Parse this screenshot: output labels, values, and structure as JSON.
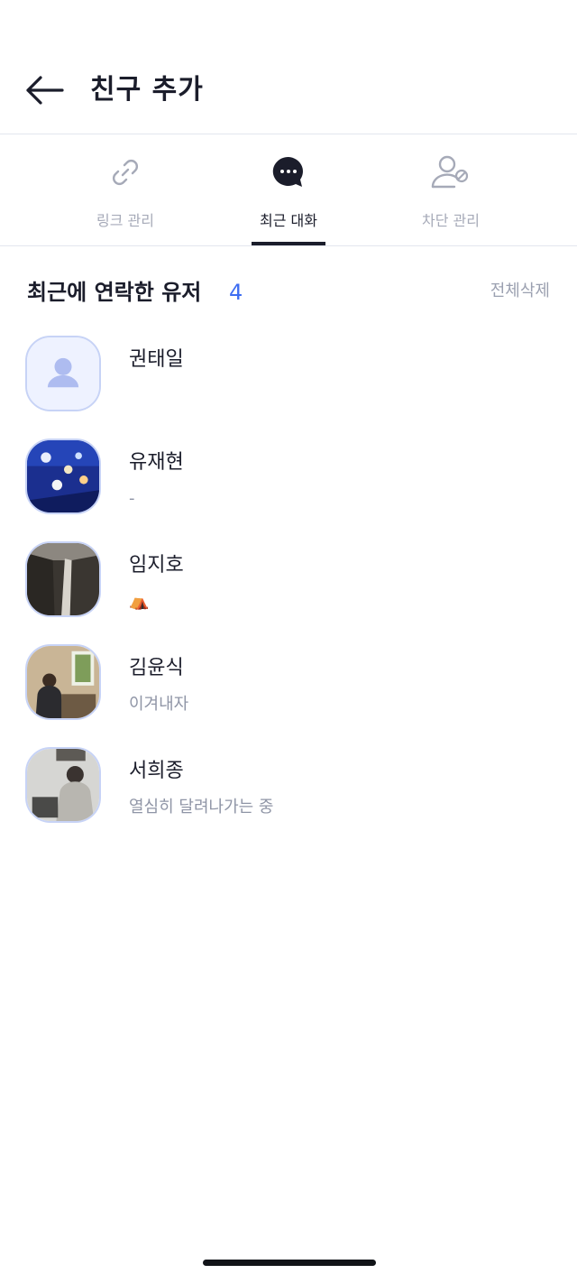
{
  "header": {
    "title": "친구 추가",
    "back_icon": "arrow-left-icon"
  },
  "tabs": [
    {
      "label": "링크 관리",
      "icon": "link-icon",
      "active": false
    },
    {
      "label": "최근 대화",
      "icon": "chat-bubble-icon",
      "active": true
    },
    {
      "label": "차단 관리",
      "icon": "user-block-icon",
      "active": false
    }
  ],
  "section": {
    "title": "최근에 연락한 유저",
    "count": "4",
    "delete_all": "전체삭제"
  },
  "users": [
    {
      "name": "권태일",
      "status": ""
    },
    {
      "name": "유재현",
      "status": "-"
    },
    {
      "name": "임지호",
      "status": "⛺"
    },
    {
      "name": "김윤식",
      "status": "이겨내자"
    },
    {
      "name": "서희종",
      "status": "열심히 달려나가는 중"
    }
  ],
  "colors": {
    "accent": "#3d6df2",
    "text_primary": "#1b1d2b",
    "text_muted": "#a6aab8",
    "divider": "#e3e6ee"
  }
}
